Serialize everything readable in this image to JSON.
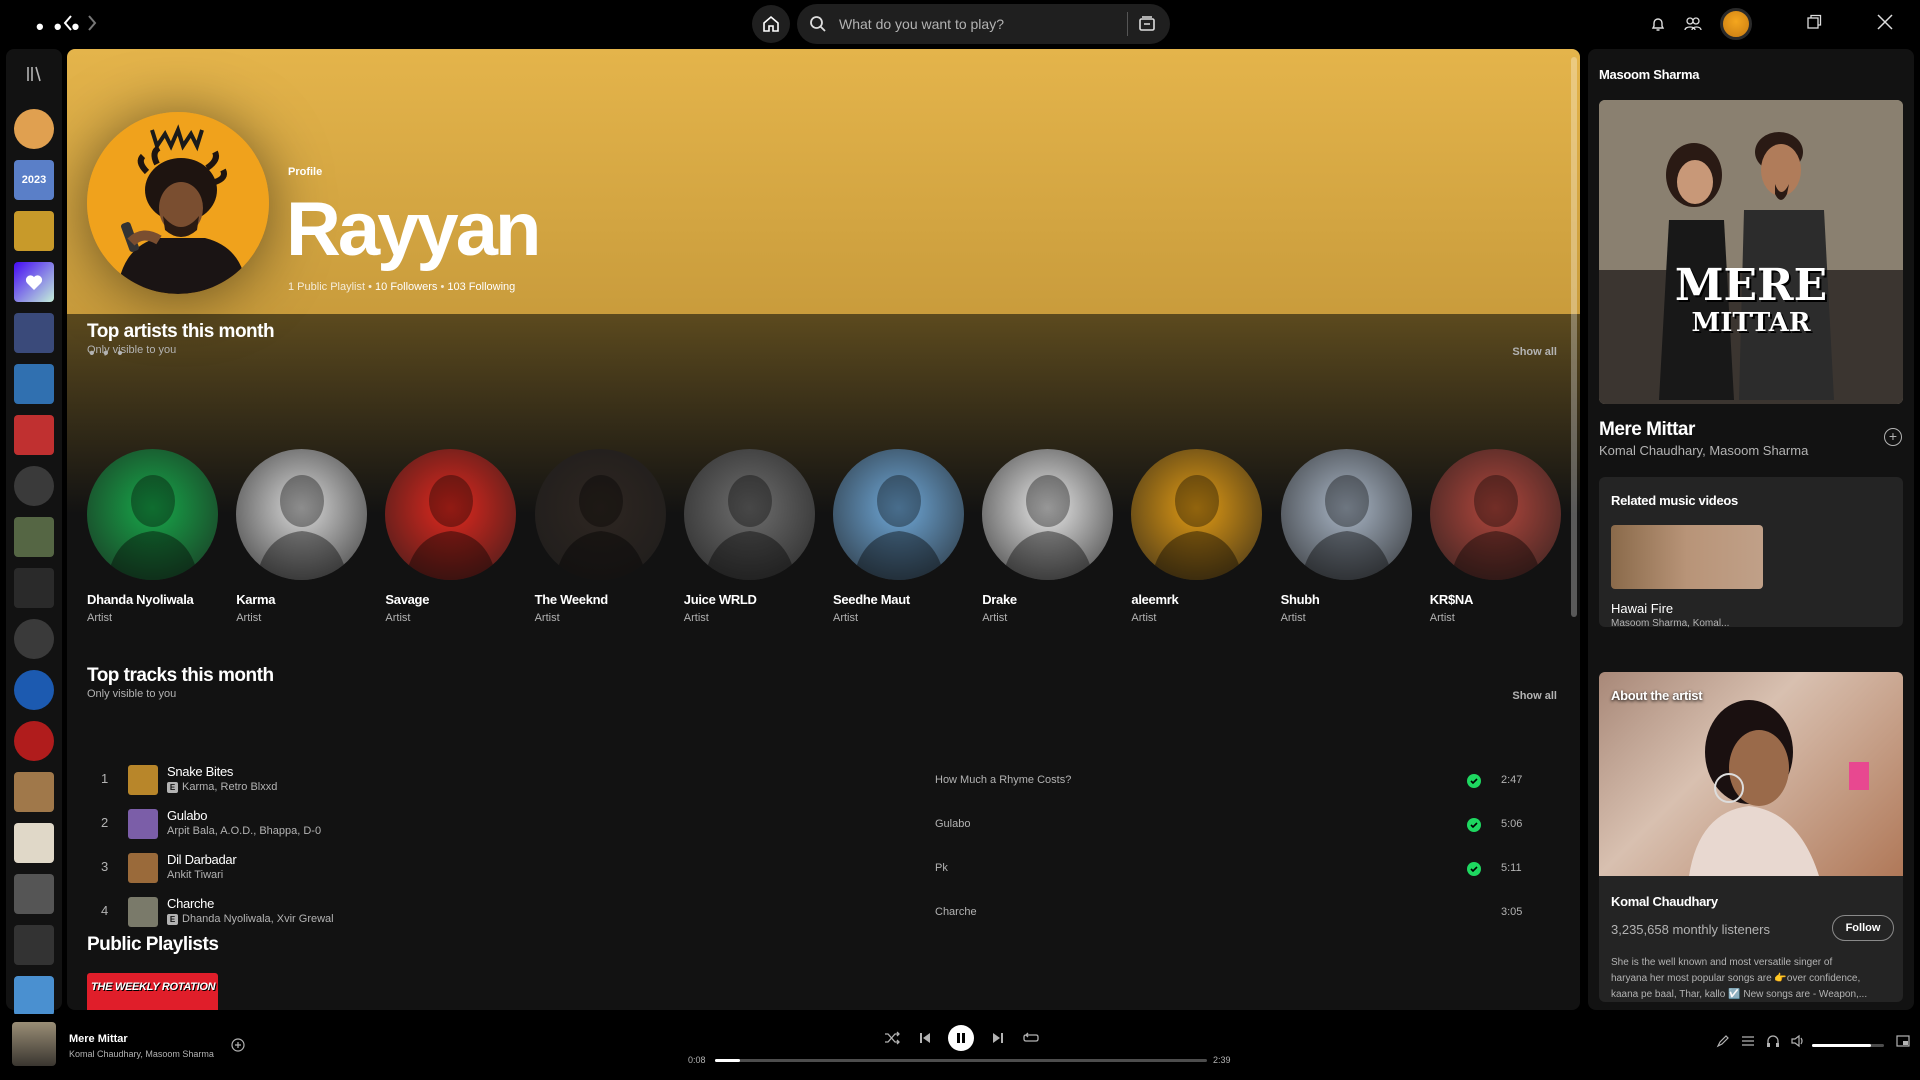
{
  "topbar": {
    "search_placeholder": "What do you want to play?"
  },
  "profile": {
    "label": "Profile",
    "name": "Rayyan",
    "public_playlists": "1 Public Playlist",
    "followers": "10 Followers",
    "following": "103 Following"
  },
  "top_artists": {
    "title": "Top artists this month",
    "subtitle": "Only visible to you",
    "show_all": "Show all",
    "items": [
      {
        "name": "Dhanda Nyoliwala",
        "role": "Artist",
        "color": "#18a84a"
      },
      {
        "name": "Karma",
        "role": "Artist",
        "color": "#d9d9d9"
      },
      {
        "name": "Savage",
        "role": "Artist",
        "color": "#e0281e"
      },
      {
        "name": "The Weeknd",
        "role": "Artist",
        "color": "#2e2621"
      },
      {
        "name": "Juice WRLD",
        "role": "Artist",
        "color": "#6e6e6e"
      },
      {
        "name": "Seedhe Maut",
        "role": "Artist",
        "color": "#6fa8d8"
      },
      {
        "name": "Drake",
        "role": "Artist",
        "color": "#e8e8e8"
      },
      {
        "name": "aleemrk",
        "role": "Artist",
        "color": "#e09a14"
      },
      {
        "name": "Shubh",
        "role": "Artist",
        "color": "#a9b6c6"
      },
      {
        "name": "KR$NA",
        "role": "Artist",
        "color": "#b0463c"
      }
    ]
  },
  "top_tracks": {
    "title": "Top tracks this month",
    "subtitle": "Only visible to you",
    "show_all": "Show all",
    "items": [
      {
        "num": "1",
        "title": "Snake Bites",
        "artists": "Karma, Retro Blxxd",
        "explicit": true,
        "album": "How Much a Rhyme Costs?",
        "saved": true,
        "duration": "2:47",
        "color": "#b8862a"
      },
      {
        "num": "2",
        "title": "Gulabo",
        "artists": "Arpit Bala, A.O.D., Bhappa, D-0",
        "explicit": false,
        "album": "Gulabo",
        "saved": true,
        "duration": "5:06",
        "color": "#7b5ea8"
      },
      {
        "num": "3",
        "title": "Dil Darbadar",
        "artists": "Ankit Tiwari",
        "explicit": false,
        "album": "Pk",
        "saved": true,
        "duration": "5:11",
        "color": "#9a6a3a"
      },
      {
        "num": "4",
        "title": "Charche",
        "artists": "Dhanda Nyoliwala, Xvir Grewal",
        "explicit": true,
        "album": "Charche",
        "saved": false,
        "duration": "3:05",
        "color": "#7a7a6a"
      }
    ]
  },
  "public_playlists": {
    "title": "Public Playlists",
    "first_cover_text": "THE WEEKLY ROTATION"
  },
  "right_panel": {
    "header": "Masoom Sharma",
    "cover_title_line1": "MERE",
    "cover_title_line2": "MITTAR",
    "song": "Mere Mittar",
    "artists": "Komal Chaudhary, Masoom Sharma",
    "related_title": "Related music videos",
    "video_title": "Hawai Fire",
    "video_artists": "Masoom Sharma, Komal...",
    "about_title": "About the artist",
    "artist_name": "Komal Chaudhary",
    "monthly_listeners": "3,235,658 monthly listeners",
    "follow_label": "Follow",
    "bio_line1": "She is the well known and most versatile singer of",
    "bio_line2": "haryana her most popular songs are 👉over confidence,",
    "bio_line3": "kaana pe baal, Thar, kallo ☑️ New songs are - Weapon,..."
  },
  "player": {
    "title": "Mere Mittar",
    "artists": "Komal Chaudhary, Masoom Sharma",
    "elapsed": "0:08",
    "total": "2:39",
    "progress_fraction": 0.05,
    "volume_fraction": 0.82
  },
  "sidebar": {
    "thumbs": [
      {
        "color": "#e0a050",
        "round": true
      },
      {
        "color": "#5a7fc8",
        "round": false,
        "label": "2023"
      },
      {
        "color": "#c89a2a",
        "round": false
      },
      {
        "color": "#8a55e8",
        "round": false,
        "liked": true
      },
      {
        "color": "#3a4a7a",
        "round": false
      },
      {
        "color": "#3070b0",
        "round": false
      },
      {
        "color": "#c03030",
        "round": false
      },
      {
        "color": "#3a3a3a",
        "round": true
      },
      {
        "color": "#556644",
        "round": false
      },
      {
        "color": "#2a2a2a",
        "round": false
      },
      {
        "color": "#3a3a3a",
        "round": true
      },
      {
        "color": "#1c5ab0",
        "round": true
      },
      {
        "color": "#b01c1c",
        "round": true
      },
      {
        "color": "#a0784a",
        "round": false
      },
      {
        "color": "#e0d8c8",
        "round": false
      },
      {
        "color": "#555",
        "round": false
      },
      {
        "color": "#333",
        "round": false
      },
      {
        "color": "#4a90d0",
        "round": false
      }
    ]
  }
}
